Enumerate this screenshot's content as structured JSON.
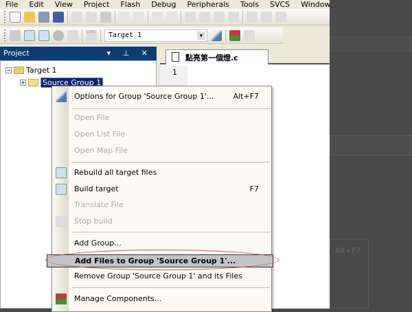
{
  "menubar": [
    "File",
    "Edit",
    "View",
    "Project",
    "Flash",
    "Debug",
    "Peripherals",
    "Tools",
    "SVCS",
    "Window"
  ],
  "toolbar": {
    "target_select": "Target 1",
    "load_label": "LOAD"
  },
  "project_panel": {
    "title": "Project",
    "controls": "▾ ⊥ ✕",
    "tree": {
      "root": "Target 1",
      "group": "Source Group 1"
    }
  },
  "editor": {
    "tab": "點亮第一個燈.c",
    "line_numbers": [
      "1"
    ]
  },
  "context_menu": {
    "items": [
      {
        "label": "Options for Group 'Source Group 1'...",
        "shortcut": "Alt+F7",
        "enabled": true,
        "icon": "magic-wand-icon"
      },
      {
        "label": "Open File",
        "enabled": false
      },
      {
        "label": "Open List File",
        "enabled": false
      },
      {
        "label": "Open Map File",
        "enabled": false
      },
      {
        "label": "Rebuild all target files",
        "enabled": true,
        "icon": "rebuild-icon"
      },
      {
        "label": "Build target",
        "shortcut": "F7",
        "enabled": true,
        "icon": "build-icon"
      },
      {
        "label": "Translate File",
        "enabled": false
      },
      {
        "label": "Stop build",
        "enabled": false,
        "icon": "stop-build-icon"
      },
      {
        "label": "Add Group...",
        "enabled": true
      },
      {
        "label": "Add Files to Group 'Source Group 1'...",
        "enabled": true,
        "highlighted": true
      },
      {
        "label": "Remove Group 'Source Group 1' and its Files",
        "enabled": true
      },
      {
        "label": "Manage Components...",
        "enabled": true,
        "icon": "components-icon"
      }
    ]
  },
  "background_ghost": {
    "shortcut": "Alt+F7"
  },
  "colors": {
    "panel_header": "#0a3d73",
    "highlight_ring": "#cc5555",
    "overlay": "#4a4a4a"
  }
}
